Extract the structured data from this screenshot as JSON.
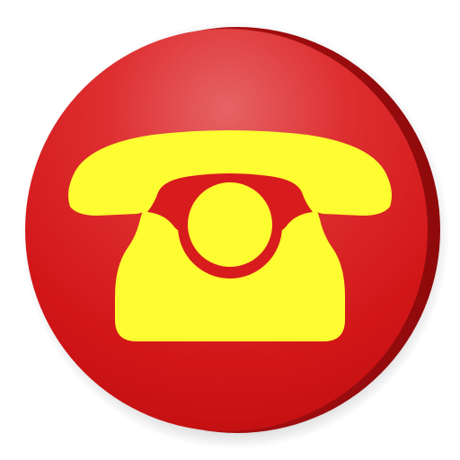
{
  "icon": {
    "name": "telephone-app-icon",
    "depicts": "phone-icon",
    "colors": {
      "circle_main": "#d9191b",
      "circle_dark": "#b31012",
      "circle_highlight": "#e45a5c",
      "rim_shadow": "#a40c0e",
      "phone_fill": "#fdfd31"
    }
  }
}
